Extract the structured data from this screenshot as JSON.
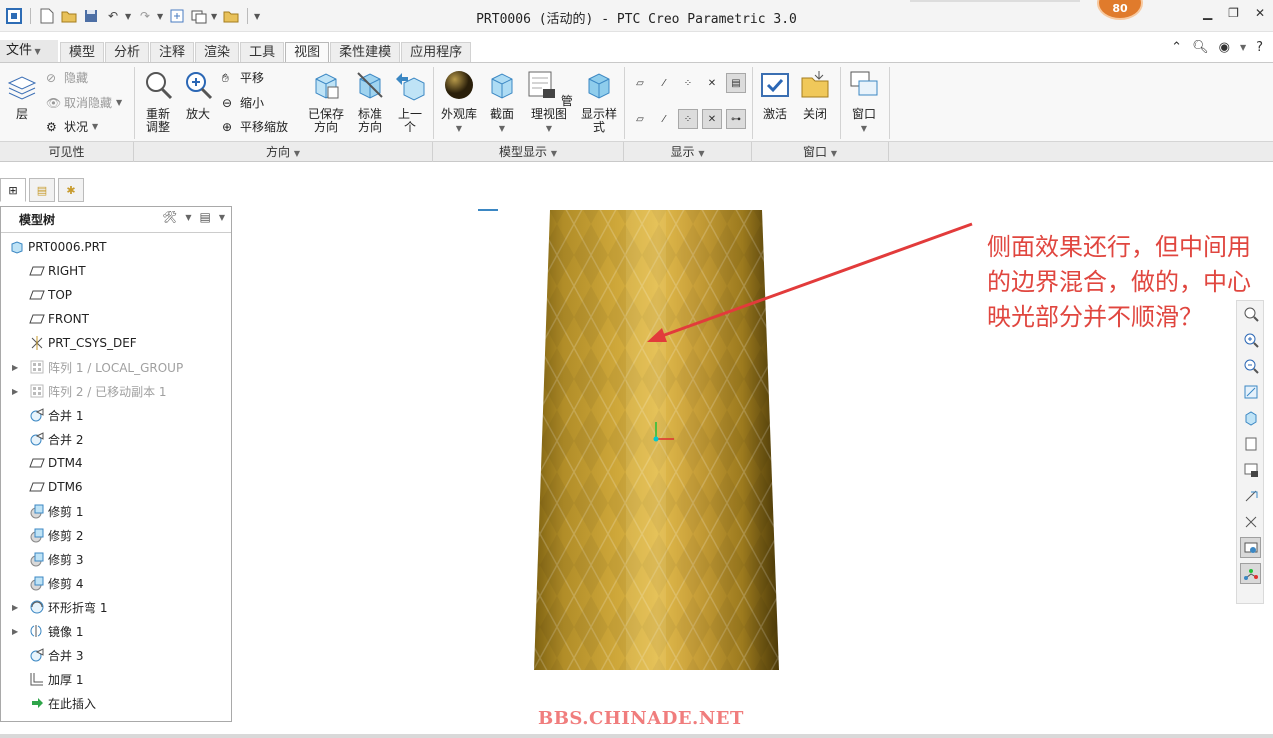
{
  "window": {
    "title": "PRT0006 (活动的) - PTC Creo Parametric 3.0",
    "badge": "80"
  },
  "colors": {
    "accent_tab": "#fafafa",
    "part_gold": "#c9a23a",
    "annotation_red": "#e0463f",
    "watermark": "#f07d7d"
  },
  "menu": {
    "file_label": "文件",
    "tabs": [
      "模型",
      "分析",
      "注释",
      "渲染",
      "工具",
      "视图",
      "柔性建模",
      "应用程序"
    ],
    "active_tab": "视图"
  },
  "ribbon": {
    "layers_label": "层",
    "hide_label": "隐藏",
    "unhide_label": "取消隐藏",
    "status_label": "状况",
    "refit_label": "重新\n调整",
    "zoom_in_label": "放大",
    "pan_label": "平移",
    "zoom_out_label": "缩小",
    "pan_zoom_label": "平移缩放",
    "saved_orient_label": "已保存\n方向",
    "std_orient_label": "标准\n方向",
    "prev_label": "上一\n个",
    "appearance_label": "外观库",
    "section_label": "截面",
    "manage_views_label": "管理视图",
    "display_style_label": "显示样\n式",
    "activate_label": "激活",
    "close_label": "关闭",
    "windows_label": "窗口",
    "groups": [
      "可见性",
      "方向",
      "模型显示",
      "显示",
      "窗口"
    ]
  },
  "model_tree": {
    "header": "模型树",
    "items": [
      {
        "label": "PRT0006.PRT",
        "icon": "part-icon",
        "indent": 0,
        "expand": false,
        "dim": false
      },
      {
        "label": "RIGHT",
        "icon": "datum-plane-icon",
        "indent": 1,
        "expand": false,
        "dim": false
      },
      {
        "label": "TOP",
        "icon": "datum-plane-icon",
        "indent": 1,
        "expand": false,
        "dim": false
      },
      {
        "label": "FRONT",
        "icon": "datum-plane-icon",
        "indent": 1,
        "expand": false,
        "dim": false
      },
      {
        "label": "PRT_CSYS_DEF",
        "icon": "csys-icon",
        "indent": 1,
        "expand": false,
        "dim": false
      },
      {
        "label": "阵列 1 / LOCAL_GROUP",
        "icon": "pattern-icon",
        "indent": 1,
        "expand": true,
        "dim": true
      },
      {
        "label": "阵列 2 / 已移动副本 1",
        "icon": "pattern-icon",
        "indent": 1,
        "expand": true,
        "dim": true
      },
      {
        "label": "合并 1",
        "icon": "merge-icon",
        "indent": 1,
        "expand": false,
        "dim": false
      },
      {
        "label": "合并 2",
        "icon": "merge-icon",
        "indent": 1,
        "expand": false,
        "dim": false
      },
      {
        "label": "DTM4",
        "icon": "datum-plane-icon",
        "indent": 1,
        "expand": false,
        "dim": false
      },
      {
        "label": "DTM6",
        "icon": "datum-plane-icon",
        "indent": 1,
        "expand": false,
        "dim": false
      },
      {
        "label": "修剪 1",
        "icon": "trim-icon",
        "indent": 1,
        "expand": false,
        "dim": false
      },
      {
        "label": "修剪 2",
        "icon": "trim-icon",
        "indent": 1,
        "expand": false,
        "dim": false
      },
      {
        "label": "修剪 3",
        "icon": "trim-icon",
        "indent": 1,
        "expand": false,
        "dim": false
      },
      {
        "label": "修剪 4",
        "icon": "trim-icon",
        "indent": 1,
        "expand": false,
        "dim": false
      },
      {
        "label": "环形折弯 1",
        "icon": "toroidal-bend-icon",
        "indent": 1,
        "expand": true,
        "dim": false
      },
      {
        "label": "镜像 1",
        "icon": "mirror-icon",
        "indent": 1,
        "expand": true,
        "dim": false
      },
      {
        "label": "合并 3",
        "icon": "merge-icon",
        "indent": 1,
        "expand": false,
        "dim": false
      },
      {
        "label": "加厚 1",
        "icon": "thicken-icon",
        "indent": 1,
        "expand": false,
        "dim": false
      },
      {
        "label": "在此插入",
        "icon": "insert-here-icon",
        "indent": 1,
        "expand": false,
        "dim": false
      }
    ]
  },
  "annotation": {
    "text": "侧面效果还行，但中间用的边界混合，做的，中心映光部分并不顺滑？"
  },
  "watermark": {
    "text": "BBS.CHINADE.NET"
  }
}
